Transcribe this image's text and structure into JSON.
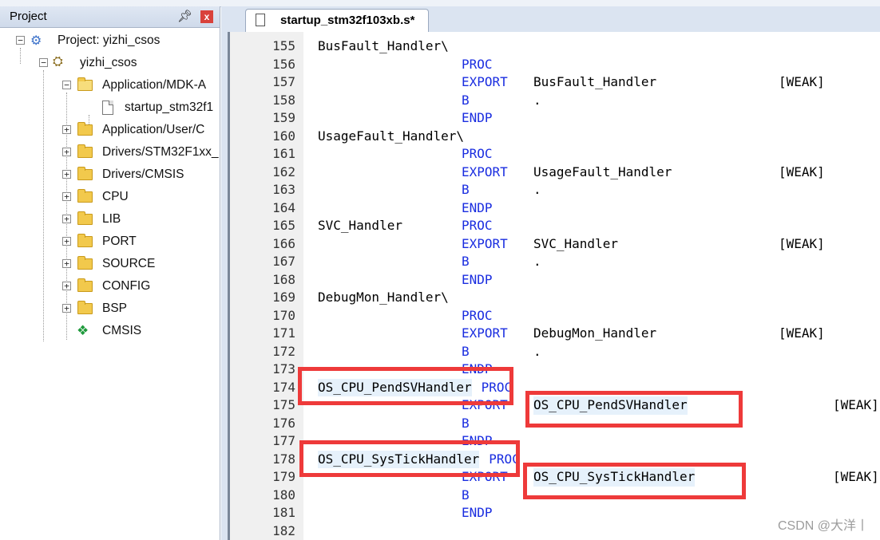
{
  "project_panel": {
    "title": "Project",
    "pin": "ᵖ",
    "close": "x"
  },
  "tree": {
    "root": "Project: yizhi_csos",
    "target": "yizhi_csos",
    "groups": [
      {
        "label": "Application/MDK-A",
        "expanded": true
      },
      {
        "label": "Application/User/C",
        "expanded": false
      },
      {
        "label": "Drivers/STM32F1xx_",
        "expanded": false
      },
      {
        "label": "Drivers/CMSIS",
        "expanded": false
      },
      {
        "label": "CPU",
        "expanded": false
      },
      {
        "label": "LIB",
        "expanded": false
      },
      {
        "label": "PORT",
        "expanded": false
      },
      {
        "label": "SOURCE",
        "expanded": false
      },
      {
        "label": "CONFIG",
        "expanded": false
      },
      {
        "label": "BSP",
        "expanded": false
      }
    ],
    "file": "startup_stm32f1",
    "cmsis": "CMSIS"
  },
  "editor": {
    "tab_label": "startup_stm32f103xb.s*",
    "lines": [
      {
        "n": "155",
        "label": "BusFault_Handler\\",
        "op": "",
        "arg": "",
        "attr": ""
      },
      {
        "n": "156",
        "label": "",
        "op": "PROC",
        "arg": "",
        "attr": ""
      },
      {
        "n": "157",
        "label": "",
        "op": "EXPORT",
        "arg": "BusFault_Handler",
        "attr": "[WEAK]"
      },
      {
        "n": "158",
        "label": "",
        "op": "B",
        "arg": ".",
        "attr": ""
      },
      {
        "n": "159",
        "label": "",
        "op": "ENDP",
        "arg": "",
        "attr": ""
      },
      {
        "n": "160",
        "label": "UsageFault_Handler\\",
        "op": "",
        "arg": "",
        "attr": ""
      },
      {
        "n": "161",
        "label": "",
        "op": "PROC",
        "arg": "",
        "attr": ""
      },
      {
        "n": "162",
        "label": "",
        "op": "EXPORT",
        "arg": "UsageFault_Handler",
        "attr": "[WEAK]"
      },
      {
        "n": "163",
        "label": "",
        "op": "B",
        "arg": ".",
        "attr": ""
      },
      {
        "n": "164",
        "label": "",
        "op": "ENDP",
        "arg": "",
        "attr": ""
      },
      {
        "n": "165",
        "label": "SVC_Handler",
        "op": "PROC",
        "arg": "",
        "attr": ""
      },
      {
        "n": "166",
        "label": "",
        "op": "EXPORT",
        "arg": "SVC_Handler",
        "attr": "[WEAK]"
      },
      {
        "n": "167",
        "label": "",
        "op": "B",
        "arg": ".",
        "attr": ""
      },
      {
        "n": "168",
        "label": "",
        "op": "ENDP",
        "arg": "",
        "attr": ""
      },
      {
        "n": "169",
        "label": "DebugMon_Handler\\",
        "op": "",
        "arg": "",
        "attr": ""
      },
      {
        "n": "170",
        "label": "",
        "op": "PROC",
        "arg": "",
        "attr": ""
      },
      {
        "n": "171",
        "label": "",
        "op": "EXPORT",
        "arg": "DebugMon_Handler",
        "attr": "[WEAK]"
      },
      {
        "n": "172",
        "label": "",
        "op": "B",
        "arg": ".",
        "attr": ""
      },
      {
        "n": "173",
        "label": "",
        "op": "ENDP",
        "arg": "",
        "attr": ""
      },
      {
        "n": "174",
        "label": "OS_CPU_PendSVHandler",
        "op": "PROC",
        "arg": "",
        "attr": ""
      },
      {
        "n": "175",
        "label": "",
        "op": "EXPORT",
        "arg": "OS_CPU_PendSVHandler",
        "attr": "[WEAK]"
      },
      {
        "n": "176",
        "label": "",
        "op": "B",
        "arg": ".",
        "attr": ""
      },
      {
        "n": "177",
        "label": "",
        "op": "ENDP",
        "arg": "",
        "attr": ""
      },
      {
        "n": "178",
        "label": "OS_CPU_SysTickHandler",
        "op": "PROC",
        "arg": "",
        "attr": ""
      },
      {
        "n": "179",
        "label": "",
        "op": "EXPORT",
        "arg": "OS_CPU_SysTickHandler",
        "attr": "[WEAK]"
      },
      {
        "n": "180",
        "label": "",
        "op": "B",
        "arg": ".",
        "attr": ""
      },
      {
        "n": "181",
        "label": "",
        "op": "ENDP",
        "arg": "",
        "attr": ""
      },
      {
        "n": "182",
        "label": "",
        "op": "",
        "arg": "",
        "attr": ""
      }
    ]
  },
  "watermark": "CSDN @大洋丨",
  "colors": {
    "keyword": "#1a2de0",
    "highlight_box": "#ee3a3a",
    "gutter": "#f0f0f0"
  }
}
